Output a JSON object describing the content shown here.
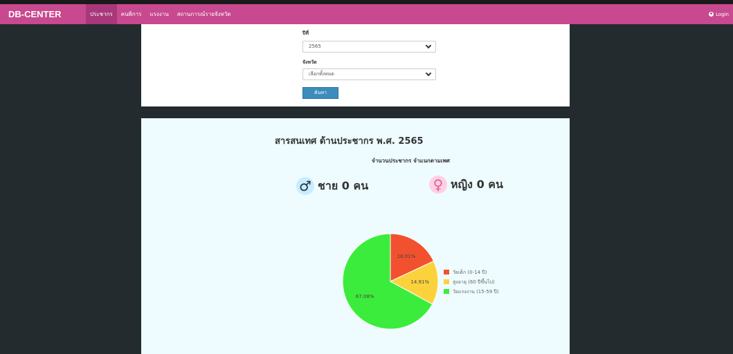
{
  "navbar": {
    "brand": "DB-CENTER",
    "items": [
      {
        "label": "ประชากร",
        "active": true
      },
      {
        "label": "คนพิการ",
        "active": false
      },
      {
        "label": "แรงงาน",
        "active": false
      },
      {
        "label": "สถานการณ์รายจังหวัด",
        "active": false
      }
    ],
    "login_label": "Login"
  },
  "form": {
    "year_label": "ปีที่",
    "year_value": "2565",
    "province_label": "จังหวัด",
    "province_value": "เลือกทั้งหมด",
    "search_button": "ค้นหา"
  },
  "info": {
    "title": "สารสนเทศ ด้านประชากร พ.ศ. 2565",
    "subtitle": "จำนวนประชากร จำแนกตามเพศ",
    "male_text": "ชาย 0 คน",
    "female_text": "หญิง 0 คน"
  },
  "chart_data": {
    "type": "pie",
    "slices": [
      {
        "label": "วัยเด็ก (0-14 ปี)",
        "value": 18.01,
        "display": "18.01%",
        "color": "#f2512f"
      },
      {
        "label": "สูงอายุ (60 ปีขึ้นไป)",
        "value": 14.91,
        "display": "14.91%",
        "color": "#fcd23c"
      },
      {
        "label": "วัยแรงงาน (15-59 ปี)",
        "value": 67.08,
        "display": "67.08%",
        "color": "#3cec3c"
      }
    ],
    "legend_position": "right"
  }
}
